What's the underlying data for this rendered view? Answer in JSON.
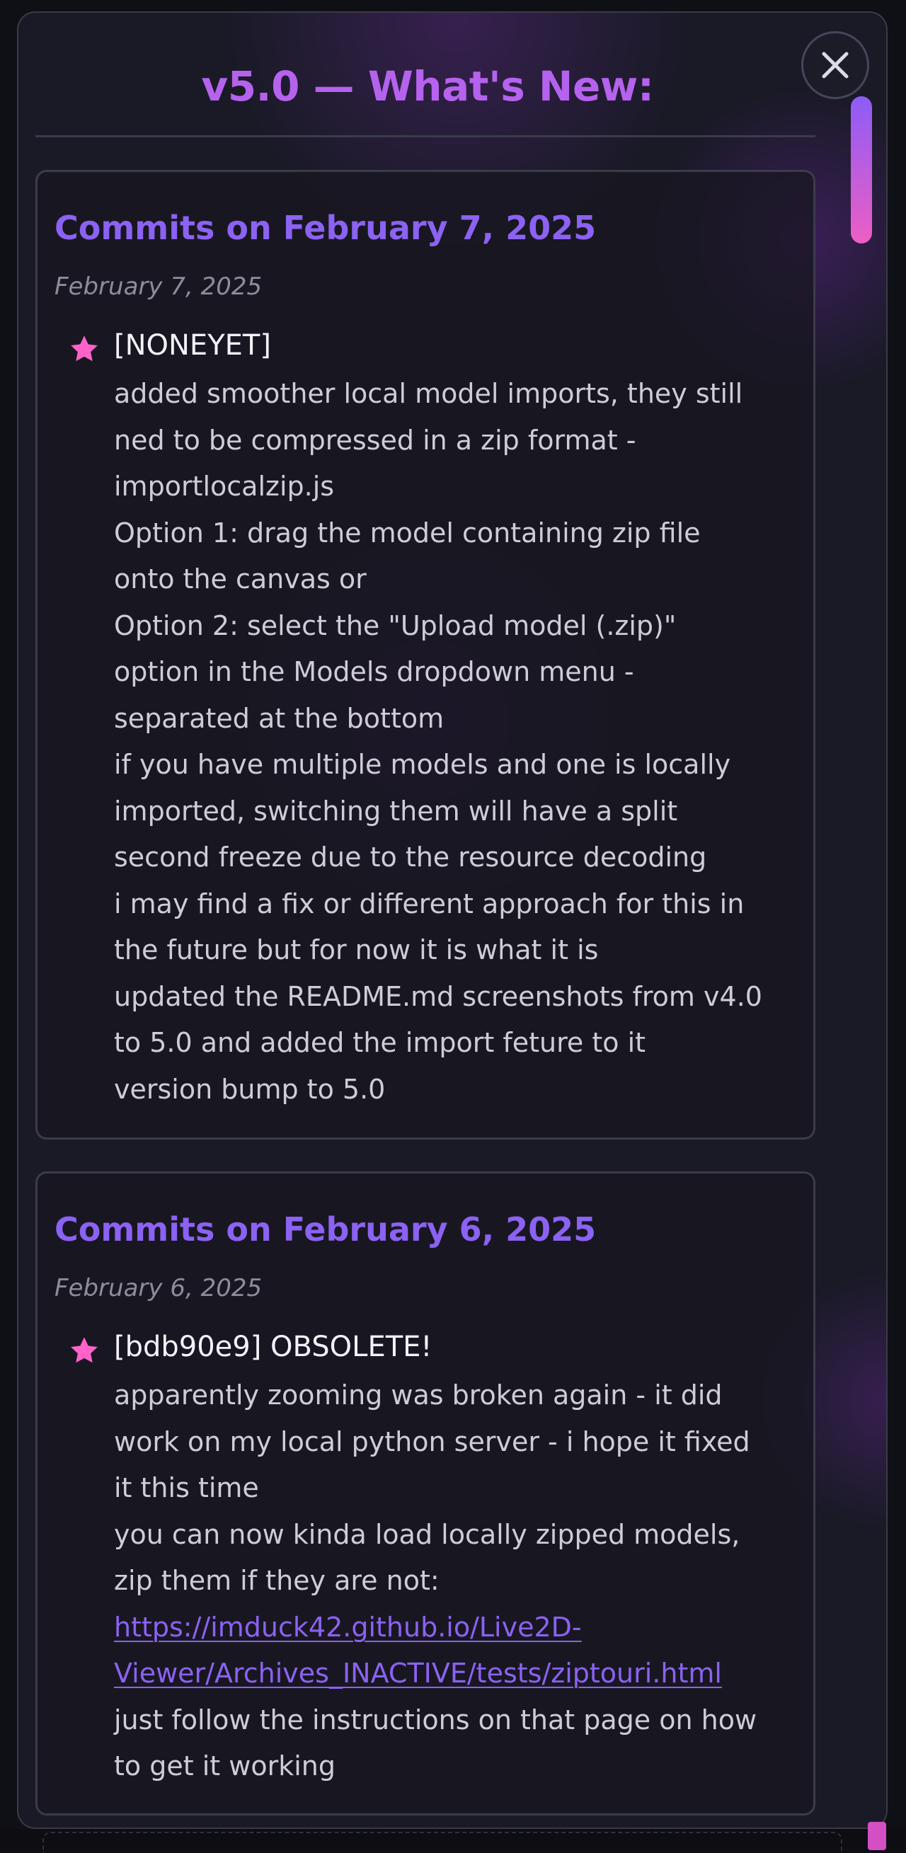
{
  "modal": {
    "title": "v5.0 — What's New:",
    "close_icon": "close-icon",
    "accent_color": "#b562ee",
    "heading_color": "#8b62f2",
    "star_color": "#ff63c9"
  },
  "commits": [
    {
      "title": "Commits on February 7, 2025",
      "date": "February 7, 2025",
      "hash_label": "[NONEYET]",
      "lines": [
        "added smoother local model imports, they still",
        "ned to be compressed in a zip format -",
        "importlocalzip.js",
        "Option 1: drag the model containing zip file",
        "onto the canvas or",
        "Option 2: select the \"Upload model (.zip)\"",
        "option in the Models dropdown menu -",
        "separated at the bottom",
        "if you have multiple models and one is locally",
        "imported, switching them will have a split",
        "second freeze due to the resource decoding",
        "i may find a fix or different approach for this in",
        "the future but for now it is what it is",
        "updated the README.md screenshots from v4.0",
        "to 5.0 and added the import feture to it",
        "version bump to 5.0"
      ]
    },
    {
      "title": "Commits on February 6, 2025",
      "date": "February 6, 2025",
      "hash_label": "[bdb90e9] OBSOLETE!",
      "lines": [
        "apparently zooming was broken again - it did",
        "work on my local python server - i hope it fixed",
        "it this time",
        "you can now kinda load locally zipped models,",
        "zip them if they are not:"
      ],
      "link_lines": [
        "https://imduck42.github.io/Live2D-",
        "Viewer/Archives_INACTIVE/tests/ziptouri.html"
      ],
      "after_lines": [
        "just follow the instructions on that page on how",
        "to get it working"
      ]
    }
  ]
}
